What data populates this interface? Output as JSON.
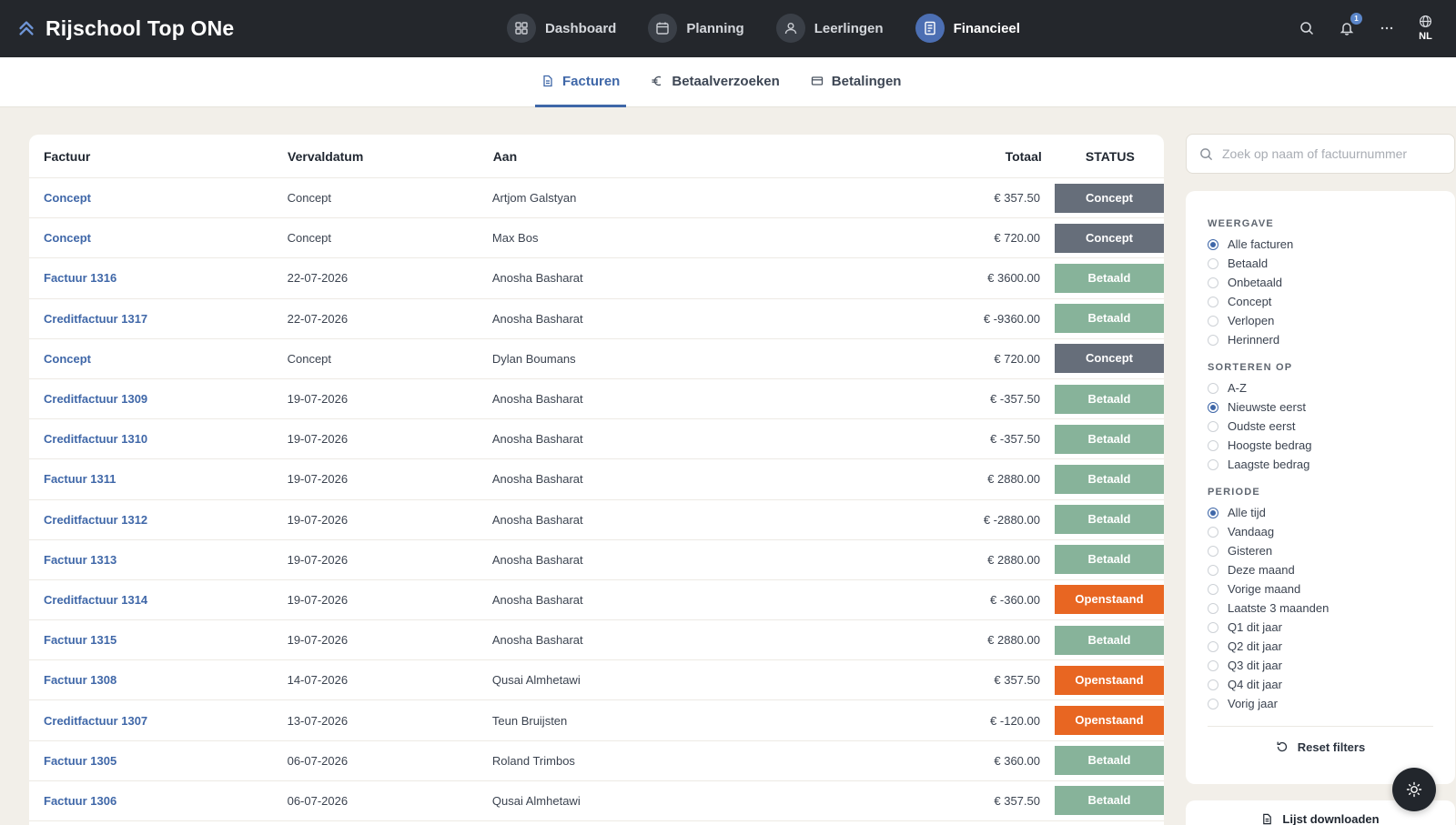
{
  "app": {
    "title": "Rijschool Top ONe"
  },
  "nav": [
    {
      "label": "Dashboard",
      "icon": "grid-icon",
      "active": false
    },
    {
      "label": "Planning",
      "icon": "calendar-icon",
      "active": false
    },
    {
      "label": "Leerlingen",
      "icon": "user-icon",
      "active": false
    },
    {
      "label": "Financieel",
      "icon": "invoice-icon",
      "active": true
    }
  ],
  "top_actions": {
    "notifications_count": "1",
    "language": "NL"
  },
  "subtabs": [
    {
      "label": "Facturen",
      "icon": "document-icon",
      "active": true
    },
    {
      "label": "Betaalverzoeken",
      "icon": "euro-icon",
      "active": false
    },
    {
      "label": "Betalingen",
      "icon": "card-icon",
      "active": false
    }
  ],
  "table": {
    "headers": {
      "factuur": "Factuur",
      "vervaldatum": "Vervaldatum",
      "aan": "Aan",
      "totaal": "Totaal",
      "status": "STATUS"
    },
    "rows": [
      {
        "factuur": "Concept",
        "vervaldatum": "Concept",
        "aan": "Artjom Galstyan",
        "totaal": "€ 357.50",
        "status": "Concept"
      },
      {
        "factuur": "Concept",
        "vervaldatum": "Concept",
        "aan": "Max Bos",
        "totaal": "€ 720.00",
        "status": "Concept"
      },
      {
        "factuur": "Factuur 1316",
        "vervaldatum": "22-07-2026",
        "aan": "Anosha Basharat",
        "totaal": "€ 3600.00",
        "status": "Betaald"
      },
      {
        "factuur": "Creditfactuur 1317",
        "vervaldatum": "22-07-2026",
        "aan": "Anosha Basharat",
        "totaal": "€ -9360.00",
        "status": "Betaald"
      },
      {
        "factuur": "Concept",
        "vervaldatum": "Concept",
        "aan": "Dylan Boumans",
        "totaal": "€ 720.00",
        "status": "Concept"
      },
      {
        "factuur": "Creditfactuur 1309",
        "vervaldatum": "19-07-2026",
        "aan": "Anosha Basharat",
        "totaal": "€ -357.50",
        "status": "Betaald"
      },
      {
        "factuur": "Creditfactuur 1310",
        "vervaldatum": "19-07-2026",
        "aan": "Anosha Basharat",
        "totaal": "€ -357.50",
        "status": "Betaald"
      },
      {
        "factuur": "Factuur 1311",
        "vervaldatum": "19-07-2026",
        "aan": "Anosha Basharat",
        "totaal": "€ 2880.00",
        "status": "Betaald"
      },
      {
        "factuur": "Creditfactuur 1312",
        "vervaldatum": "19-07-2026",
        "aan": "Anosha Basharat",
        "totaal": "€ -2880.00",
        "status": "Betaald"
      },
      {
        "factuur": "Factuur 1313",
        "vervaldatum": "19-07-2026",
        "aan": "Anosha Basharat",
        "totaal": "€ 2880.00",
        "status": "Betaald"
      },
      {
        "factuur": "Creditfactuur 1314",
        "vervaldatum": "19-07-2026",
        "aan": "Anosha Basharat",
        "totaal": "€ -360.00",
        "status": "Openstaand"
      },
      {
        "factuur": "Factuur 1315",
        "vervaldatum": "19-07-2026",
        "aan": "Anosha Basharat",
        "totaal": "€ 2880.00",
        "status": "Betaald"
      },
      {
        "factuur": "Factuur 1308",
        "vervaldatum": "14-07-2026",
        "aan": "Qusai Almhetawi",
        "totaal": "€ 357.50",
        "status": "Openstaand"
      },
      {
        "factuur": "Creditfactuur 1307",
        "vervaldatum": "13-07-2026",
        "aan": "Teun Bruijsten",
        "totaal": "€ -120.00",
        "status": "Openstaand"
      },
      {
        "factuur": "Factuur 1305",
        "vervaldatum": "06-07-2026",
        "aan": "Roland Trimbos",
        "totaal": "€ 360.00",
        "status": "Betaald"
      },
      {
        "factuur": "Factuur 1306",
        "vervaldatum": "06-07-2026",
        "aan": "Qusai Almhetawi",
        "totaal": "€ 357.50",
        "status": "Betaald"
      }
    ]
  },
  "status_colors": {
    "Concept": "#666e7a",
    "Betaald": "#87b39a",
    "Openstaand": "#e86622"
  },
  "search": {
    "placeholder": "Zoek op naam of factuurnummer",
    "value": ""
  },
  "filters": {
    "groups": [
      {
        "title": "WEERGAVE",
        "options": [
          "Alle facturen",
          "Betaald",
          "Onbetaald",
          "Concept",
          "Verlopen",
          "Herinnerd"
        ],
        "selected": "Alle facturen"
      },
      {
        "title": "SORTEREN OP",
        "options": [
          "A-Z",
          "Nieuwste eerst",
          "Oudste eerst",
          "Hoogste bedrag",
          "Laagste bedrag"
        ],
        "selected": "Nieuwste eerst"
      },
      {
        "title": "PERIODE",
        "options": [
          "Alle tijd",
          "Vandaag",
          "Gisteren",
          "Deze maand",
          "Vorige maand",
          "Laatste 3 maanden",
          "Q1 dit jaar",
          "Q2 dit jaar",
          "Q3 dit jaar",
          "Q4 dit jaar",
          "Vorig jaar"
        ],
        "selected": "Alle tijd"
      }
    ],
    "reset_label": "Reset filters"
  },
  "download_label": "Lijst downloaden",
  "colors": {
    "accent": "#3f67a8",
    "topbar": "#24272c",
    "background": "#f2efe9"
  }
}
